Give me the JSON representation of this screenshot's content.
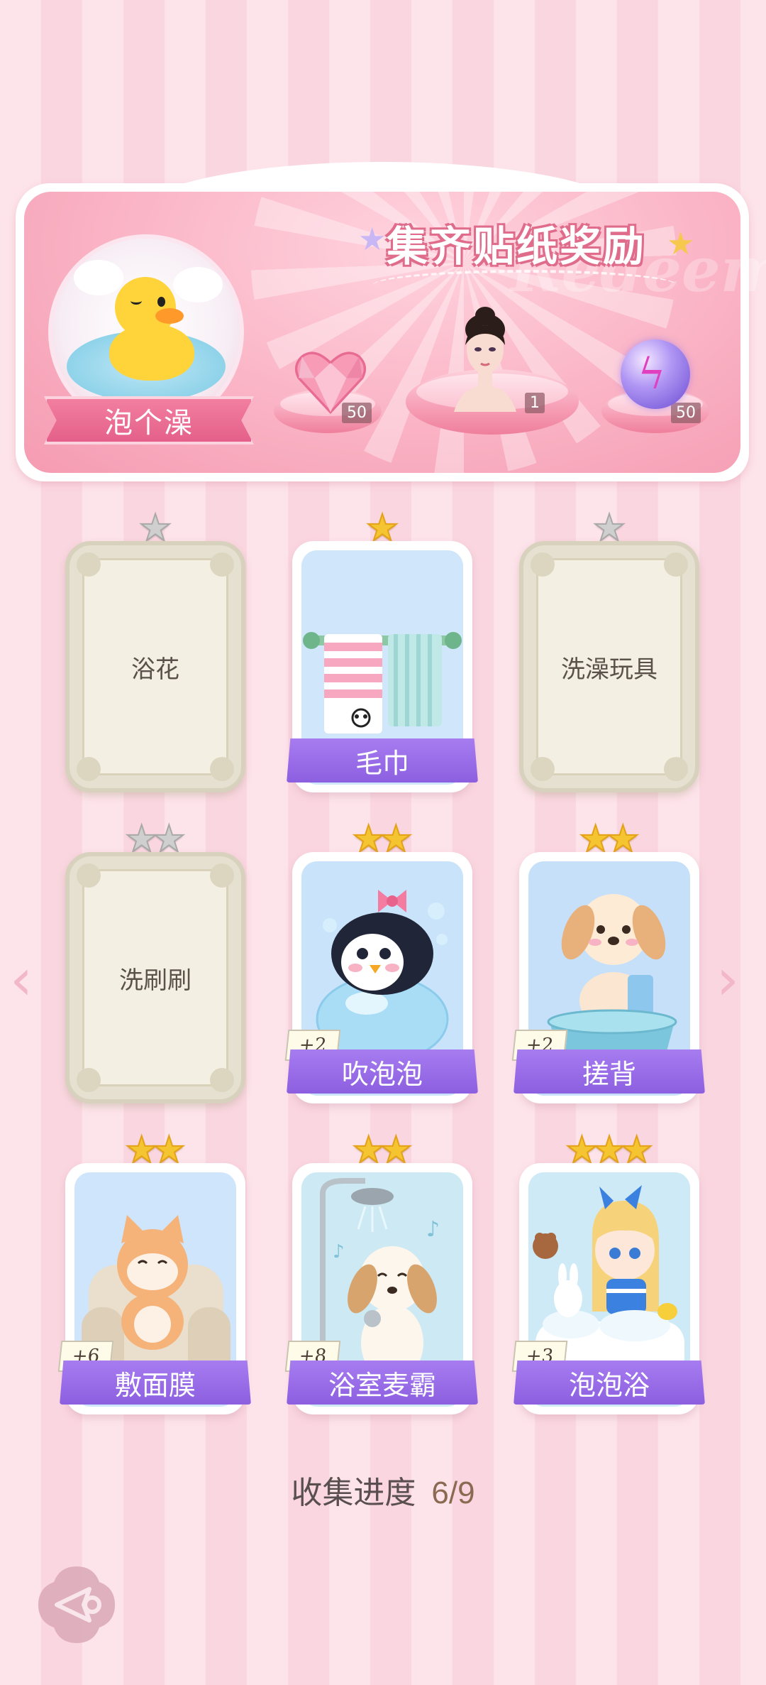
{
  "banner": {
    "title": "集齐贴纸奖励",
    "watermark": "Redeem",
    "event_name": "泡个澡",
    "rewards": [
      {
        "icon": "pink-heart-gem-icon",
        "count": "50"
      },
      {
        "icon": "character-portrait",
        "count": "1"
      },
      {
        "icon": "purple-lightning-orb-icon",
        "count": "50"
      }
    ]
  },
  "cards": [
    {
      "name": "浴花",
      "stars": 1,
      "collected": false,
      "bonus": ""
    },
    {
      "name": "毛巾",
      "stars": 1,
      "collected": true,
      "bonus": ""
    },
    {
      "name": "洗澡玩具",
      "stars": 1,
      "collected": false,
      "bonus": ""
    },
    {
      "name": "洗刷刷",
      "stars": 2,
      "collected": false,
      "bonus": ""
    },
    {
      "name": "吹泡泡",
      "stars": 2,
      "collected": true,
      "bonus": "+2"
    },
    {
      "name": "搓背",
      "stars": 2,
      "collected": true,
      "bonus": "+2"
    },
    {
      "name": "敷面膜",
      "stars": 2,
      "collected": true,
      "bonus": "+6"
    },
    {
      "name": "浴室麦霸",
      "stars": 2,
      "collected": true,
      "bonus": "+8"
    },
    {
      "name": "泡泡浴",
      "stars": 3,
      "collected": true,
      "bonus": "+3"
    }
  ],
  "progress": {
    "label": "收集进度",
    "value": "6/9"
  },
  "nav": {
    "prev": "‹",
    "next": "›"
  },
  "colors": {
    "accent_pink": "#f27fa0",
    "name_bar_purple": "#9a6ee8",
    "star_gold": "#f5c431"
  }
}
